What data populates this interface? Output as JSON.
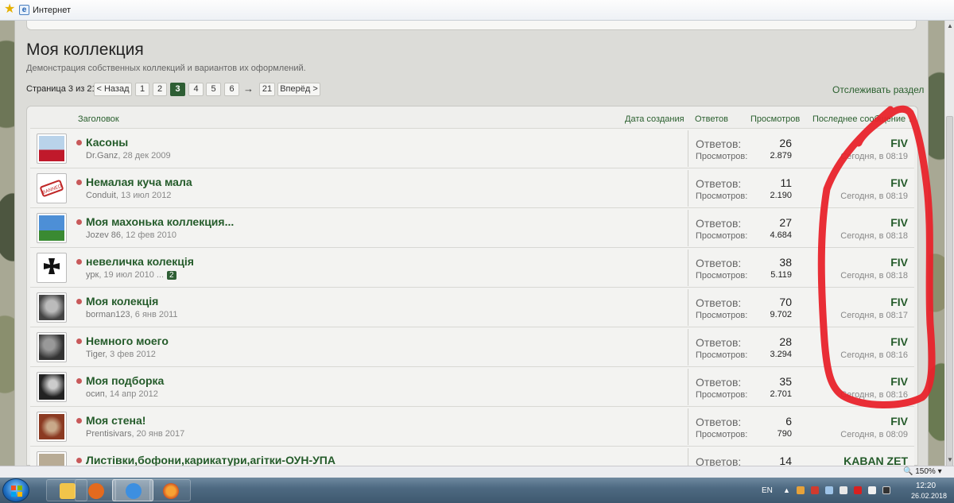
{
  "browser": {
    "favorites_label": "Интернет",
    "zoom": "150%"
  },
  "forum": {
    "title": "Моя коллекция",
    "description": "Демонстрация собственных коллекций и вариантов их оформлений.",
    "page_info": "Страница 3 из 21",
    "pagination": {
      "prev": "< Назад",
      "pages": [
        "1",
        "2",
        "3",
        "4",
        "5",
        "6"
      ],
      "current": "3",
      "arrow": "→",
      "last": "21",
      "next": "Вперёд >"
    },
    "watch_label": "Отслеживать раздел",
    "columns": {
      "title": "Заголовок",
      "created": "Дата создания",
      "replies": "Ответов",
      "views": "Просмотров",
      "last": "Последнее сообщение ↓"
    }
  },
  "stats_labels": {
    "replies": "Ответов:",
    "views": "Просмотров:"
  },
  "threads": [
    {
      "title": "Касоны",
      "author": "Dr.Ganz",
      "date": ", 28 дек 2009",
      "replies": "26",
      "views": "2.879",
      "last_user": "FIV",
      "last_time": "Сегодня, в 08:19",
      "page_badge": ""
    },
    {
      "title": "Немалая куча мала",
      "author": "Conduit",
      "date": ", 13 июл 2012",
      "replies": "11",
      "views": "2.190",
      "last_user": "FIV",
      "last_time": "Сегодня, в 08:19",
      "page_badge": ""
    },
    {
      "title": "Моя махонька коллекция...",
      "author": "Jozev 86",
      "date": ", 12 фев 2010",
      "replies": "27",
      "views": "4.684",
      "last_user": "FIV",
      "last_time": "Сегодня, в 08:18",
      "page_badge": ""
    },
    {
      "title": "невеличка колекція",
      "author": "урк",
      "date": ", 19 июл 2010  ...",
      "replies": "38",
      "views": "5.119",
      "last_user": "FIV",
      "last_time": "Сегодня, в 08:18",
      "page_badge": "2"
    },
    {
      "title": "Моя колекція",
      "author": "borman123",
      "date": ", 6 янв 2011",
      "replies": "70",
      "views": "9.702",
      "last_user": "FIV",
      "last_time": "Сегодня, в 08:17",
      "page_badge": ""
    },
    {
      "title": "Немного моего",
      "author": "Tiger",
      "date": ", 3 фев 2012",
      "replies": "28",
      "views": "3.294",
      "last_user": "FIV",
      "last_time": "Сегодня, в 08:16",
      "page_badge": ""
    },
    {
      "title": "Моя подборка",
      "author": "осип",
      "date": ", 14 апр 2012",
      "replies": "35",
      "views": "2.701",
      "last_user": "FIV",
      "last_time": "Сегодня, в 08:16",
      "page_badge": ""
    },
    {
      "title": "Моя стена!",
      "author": "Prentisivars",
      "date": ", 20 янв 2017",
      "replies": "6",
      "views": "790",
      "last_user": "FIV",
      "last_time": "Сегодня, в 08:09",
      "page_badge": ""
    },
    {
      "title": "Листівки,бофони,карикатури,агітки-ОУН-УПА",
      "author": "",
      "date": "",
      "replies": "14",
      "views": "",
      "last_user": "KABAN ZET",
      "last_time": "",
      "page_badge": ""
    }
  ],
  "taskbar": {
    "lang": "EN",
    "time": "12:20",
    "date": "26.02.2018"
  },
  "colors": {
    "accent": "#2e5e34",
    "link": "#245b2a",
    "annotation": "#e8232b"
  }
}
